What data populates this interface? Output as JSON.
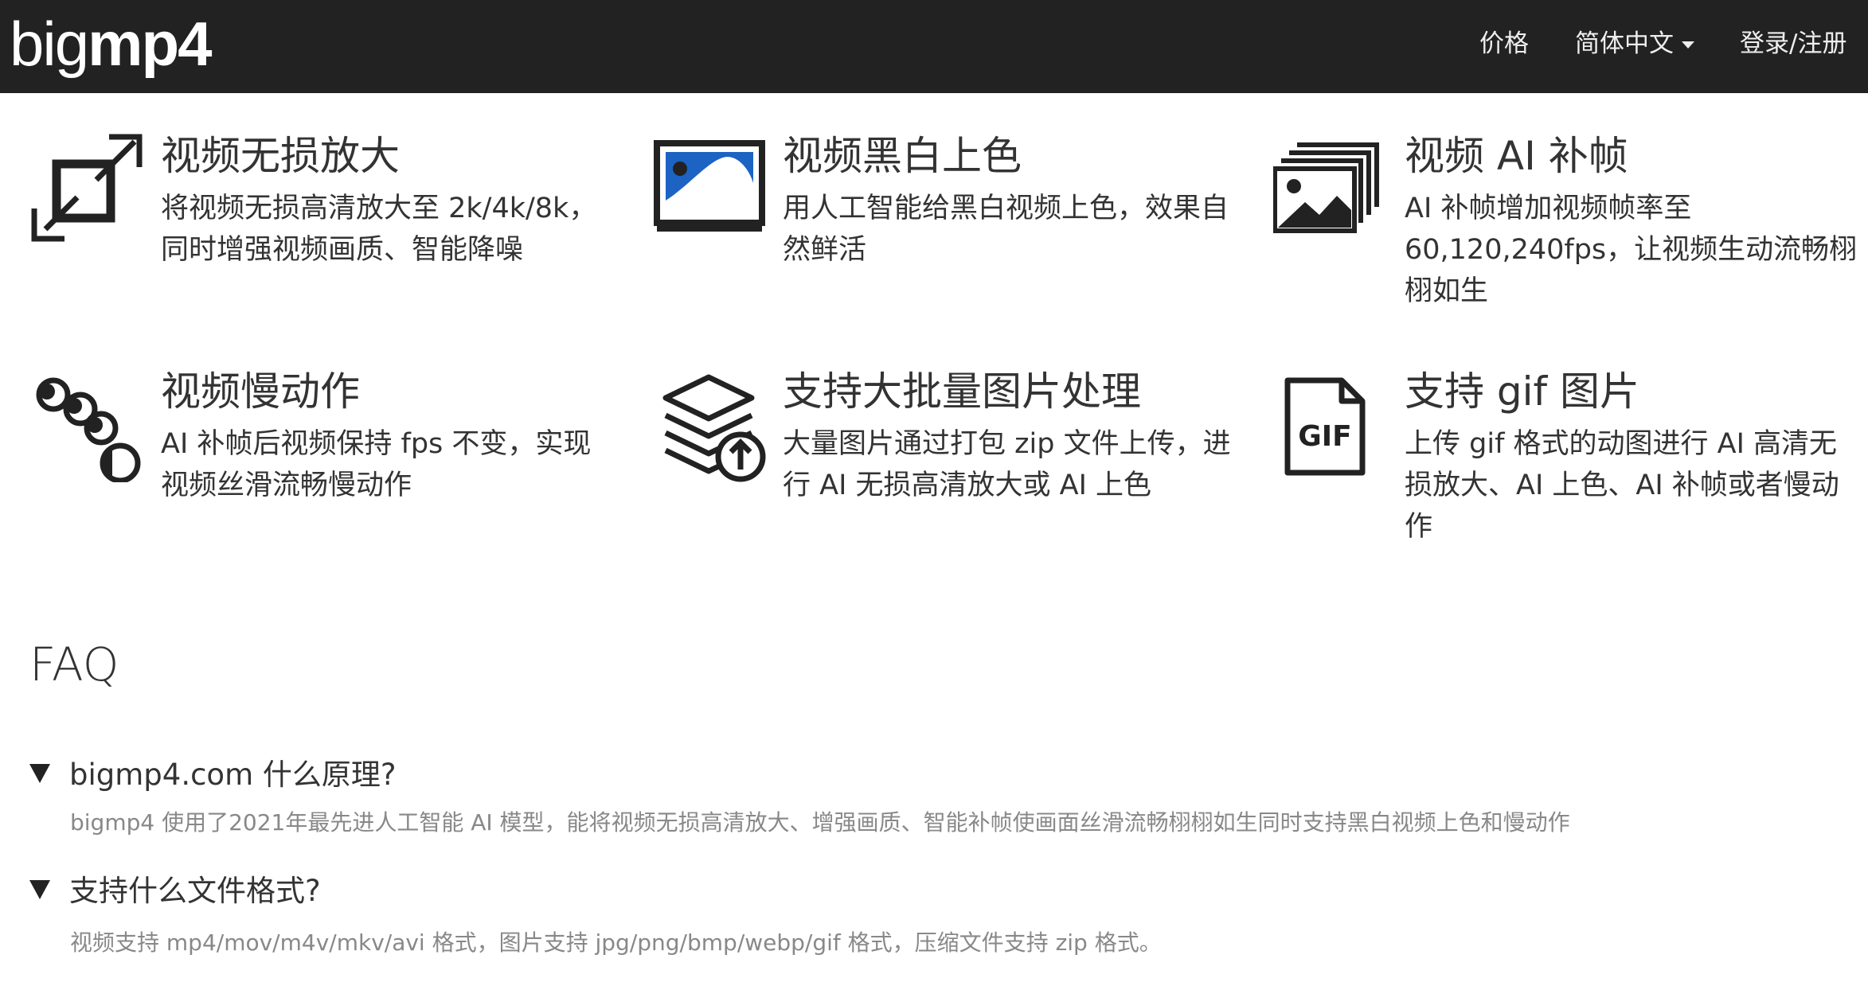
{
  "nav": {
    "logo_thin": "big",
    "logo_bold": "mp4",
    "price": "价格",
    "language": "简体中文",
    "login": "登录/注册"
  },
  "features": [
    {
      "icon": "enlarge-icon",
      "title": "视频无损放大",
      "desc": "将视频无损高清放大至 2k/4k/8k，同时增强视频画质、智能降噪"
    },
    {
      "icon": "colorize-image-icon",
      "title": "视频黑白上色",
      "desc": "用人工智能给黑白视频上色，效果自然鲜活"
    },
    {
      "icon": "image-stack-icon",
      "title": "视频 AI 补帧",
      "desc": "AI 补帧增加视频帧率至 60,120,240fps，让视频生动流畅栩栩如生"
    },
    {
      "icon": "slow-motion-icon",
      "title": "视频慢动作",
      "desc": "AI 补帧后视频保持 fps 不变，实现视频丝滑流畅慢动作"
    },
    {
      "icon": "layers-upload-icon",
      "title": "支持大批量图片处理",
      "desc": "大量图片通过打包 zip 文件上传，进行 AI 无损高清放大或 AI 上色"
    },
    {
      "icon": "gif-file-icon",
      "title": "支持 gif 图片",
      "desc": "上传 gif 格式的动图进行 AI 高清无损放大、AI 上色、AI 补帧或者慢动作"
    }
  ],
  "faq": {
    "title": "FAQ",
    "items": [
      {
        "q": "bigmp4.com 什么原理?",
        "a": "bigmp4 使用了2021年最先进人工智能 AI 模型，能将视频无损高清放大、增强画质、智能补帧使画面丝滑流畅栩栩如生同时支持黑白视频上色和慢动作"
      },
      {
        "q": "支持什么文件格式?",
        "a": "视频支持 mp4/mov/m4v/mkv/avi 格式，图片支持 jpg/png/bmp/webp/gif 格式，压缩文件支持 zip 格式。"
      }
    ]
  }
}
